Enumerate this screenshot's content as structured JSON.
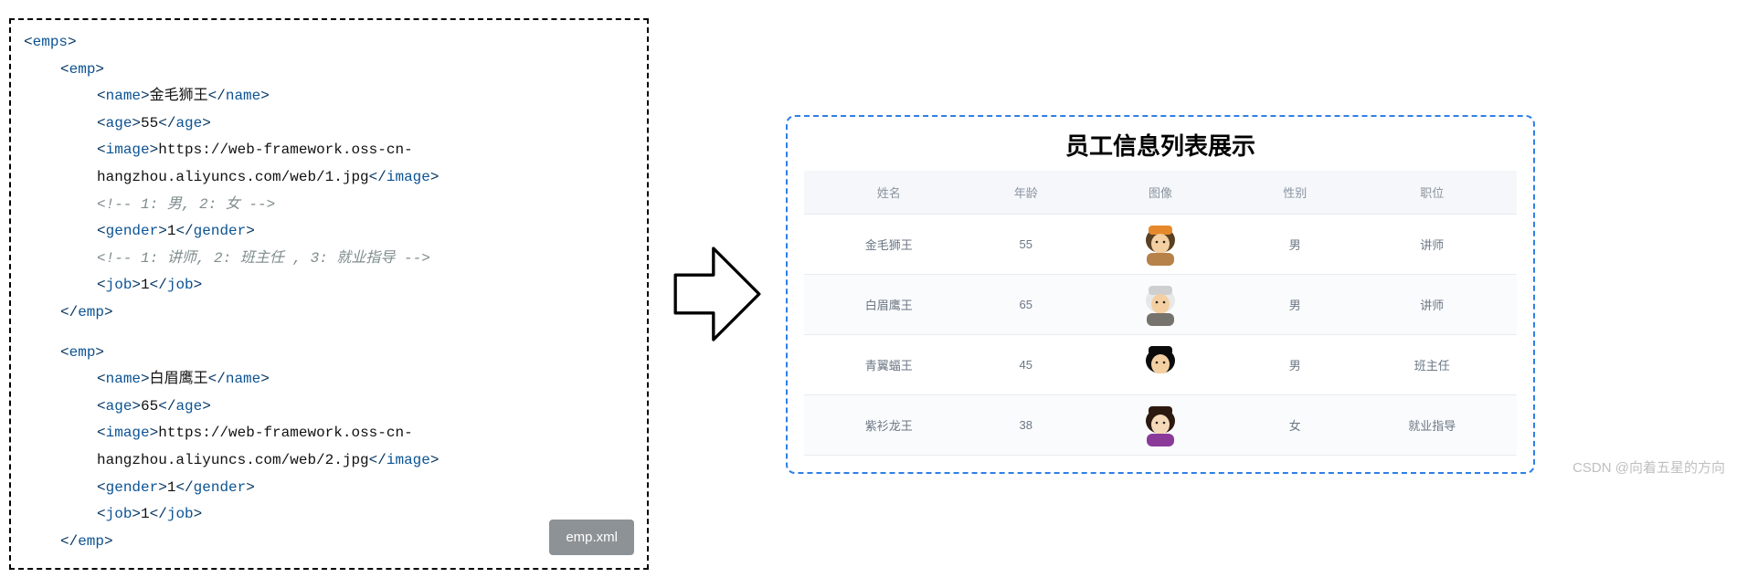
{
  "xml": {
    "root_open": "emps",
    "root_close": "emps",
    "file_badge": "emp.xml",
    "emps": [
      {
        "tag": "emp",
        "name_tag": "name",
        "name_val": "金毛狮王",
        "age_tag": "age",
        "age_val": "55",
        "image_tag": "image",
        "image_val": "https://web-framework.oss-cn-hangzhou.aliyuncs.com/web/1.jpg",
        "comment1": "<!-- 1: 男, 2: 女 -->",
        "gender_tag": "gender",
        "gender_val": "1",
        "comment2": "<!-- 1: 讲师, 2: 班主任 , 3: 就业指导 -->",
        "job_tag": "job",
        "job_val": "1"
      },
      {
        "tag": "emp",
        "name_tag": "name",
        "name_val": "白眉鹰王",
        "age_tag": "age",
        "age_val": "65",
        "image_tag": "image",
        "image_val": "https://web-framework.oss-cn-hangzhou.aliyuncs.com/web/2.jpg",
        "gender_tag": "gender",
        "gender_val": "1",
        "job_tag": "job",
        "job_val": "1"
      }
    ]
  },
  "table": {
    "title": "员工信息列表展示",
    "headers": {
      "name": "姓名",
      "age": "年龄",
      "image": "图像",
      "gender": "性别",
      "job": "职位"
    },
    "rows": [
      {
        "name": "金毛狮王",
        "age": "55",
        "gender": "男",
        "job": "讲师",
        "avatar": {
          "hair": "#594023",
          "hat": "#e6892c",
          "skin": "#f3cfa2",
          "cloth": "#b6824a"
        }
      },
      {
        "name": "白眉鹰王",
        "age": "65",
        "gender": "男",
        "job": "讲师",
        "avatar": {
          "hair": "#e8e8e8",
          "hat": "#cfcfcf",
          "skin": "#f3cfa2",
          "cloth": "#76726d"
        }
      },
      {
        "name": "青翼蝠王",
        "age": "45",
        "gender": "男",
        "job": "班主任",
        "avatar": {
          "hair": "#0b0b0b",
          "hat": "#0b0b0b",
          "skin": "#f3cfa2",
          "cloth": "#ffffff"
        }
      },
      {
        "name": "紫衫龙王",
        "age": "38",
        "gender": "女",
        "job": "就业指导",
        "avatar": {
          "hair": "#2c1a10",
          "hat": "#2c1a10",
          "skin": "#f6d9b8",
          "cloth": "#8a3b9a"
        }
      }
    ]
  },
  "watermark": "CSDN @向着五星的方向"
}
